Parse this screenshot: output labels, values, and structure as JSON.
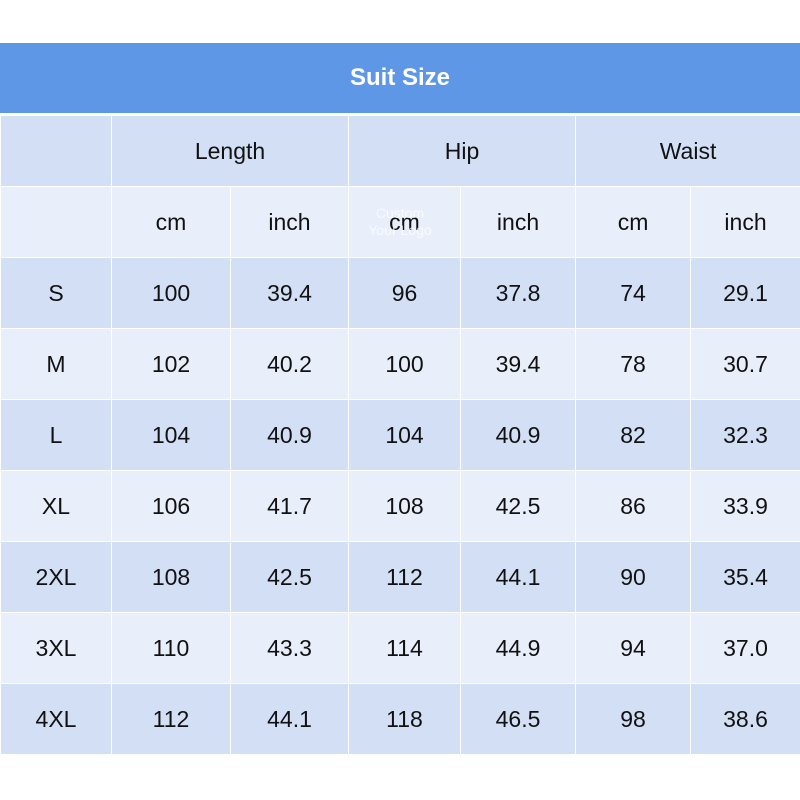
{
  "title": "Suit Size",
  "watermark": "Custom Your Logo",
  "groups": [
    "Length",
    "Hip",
    "Waist"
  ],
  "units": [
    "cm",
    "inch",
    "cm",
    "inch",
    "cm",
    "inch"
  ],
  "rows": [
    [
      "S",
      "100",
      "39.4",
      "96",
      "37.8",
      "74",
      "29.1"
    ],
    [
      "M",
      "102",
      "40.2",
      "100",
      "39.4",
      "78",
      "30.7"
    ],
    [
      "L",
      "104",
      "40.9",
      "104",
      "40.9",
      "82",
      "32.3"
    ],
    [
      "XL",
      "106",
      "41.7",
      "108",
      "42.5",
      "86",
      "33.9"
    ],
    [
      "2XL",
      "108",
      "42.5",
      "112",
      "44.1",
      "90",
      "35.4"
    ],
    [
      "3XL",
      "110",
      "43.3",
      "114",
      "44.9",
      "94",
      "37.0"
    ],
    [
      "4XL",
      "112",
      "44.1",
      "118",
      "46.5",
      "98",
      "38.6"
    ]
  ],
  "colors": {
    "header": "#5e97e6",
    "row_dark": "#d3dff5",
    "row_light": "#e8eefa"
  }
}
